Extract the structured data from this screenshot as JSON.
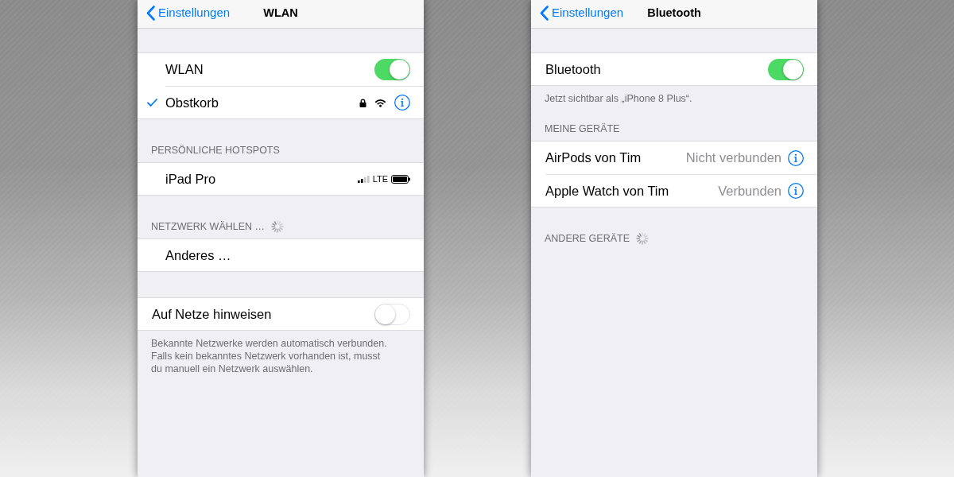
{
  "screens": [
    {
      "nav": {
        "back": "Einstellungen",
        "title": "WLAN"
      },
      "sections": [
        {
          "kind": "networks",
          "rows": [
            {
              "kind": "toggle",
              "label": "WLAN",
              "on": true
            },
            {
              "kind": "network",
              "label": "Obstkorb",
              "selected": true,
              "locked": true,
              "info": true
            }
          ]
        },
        {
          "kind": "networks",
          "header": "PERSÖNLICHE HOTSPOTS",
          "rows": [
            {
              "kind": "hotspot",
              "label": "iPad Pro",
              "selected": false,
              "network_type": "LTE"
            }
          ]
        },
        {
          "kind": "networks",
          "header": "NETZWERK WÄHLEN …",
          "loading": true,
          "rows": [
            {
              "kind": "link",
              "label": "Anderes …"
            }
          ]
        },
        {
          "kind": "plain",
          "rows": [
            {
              "kind": "toggle",
              "label": "Auf Netze hinweisen",
              "on": false
            }
          ],
          "footer": "Bekannte Netzwerke werden automatisch verbunden. Falls kein bekanntes Netzwerk vorhanden ist, musst du manuell ein Netzwerk auswählen."
        }
      ]
    },
    {
      "nav": {
        "back": "Einstellungen",
        "title": "Bluetooth"
      },
      "sections": [
        {
          "kind": "plain",
          "rows": [
            {
              "kind": "toggle",
              "label": "Bluetooth",
              "on": true
            }
          ],
          "footer": "Jetzt sichtbar als „iPhone 8 Plus“."
        },
        {
          "kind": "plain",
          "header": "MEINE GERÄTE",
          "rows": [
            {
              "kind": "device",
              "label": "AirPods von Tim",
              "status": "Nicht verbunden",
              "info": true
            },
            {
              "kind": "device",
              "label": "Apple Watch von Tim",
              "status": "Verbunden",
              "info": true
            }
          ]
        },
        {
          "kind": "plain",
          "header": "ANDERE GERÄTE",
          "loading": true
        }
      ]
    }
  ]
}
